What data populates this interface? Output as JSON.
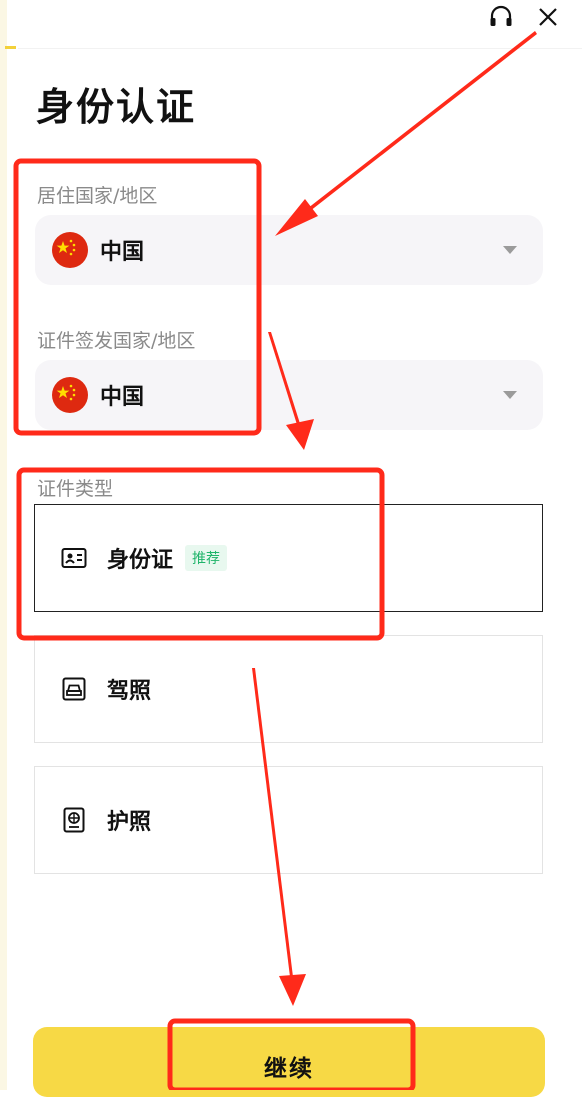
{
  "header": {
    "headset_icon": "headset-icon",
    "close_icon": "close-icon"
  },
  "page": {
    "title": "身份认证"
  },
  "residence": {
    "label": "居住国家/地区",
    "value": "中国"
  },
  "issuing": {
    "label": "证件签发国家/地区",
    "value": "中国"
  },
  "document_type": {
    "label": "证件类型",
    "options": [
      {
        "label": "身份证",
        "badge": "推荐",
        "icon": "id-card-icon",
        "selected": true
      },
      {
        "label": "驾照",
        "icon": "car-icon",
        "selected": false
      },
      {
        "label": "护照",
        "icon": "passport-icon",
        "selected": false
      }
    ]
  },
  "actions": {
    "continue_label": "继续"
  },
  "colors": {
    "accent": "#f7d945",
    "annotation": "#ff2a1a",
    "badge_text": "#1fb46a"
  }
}
